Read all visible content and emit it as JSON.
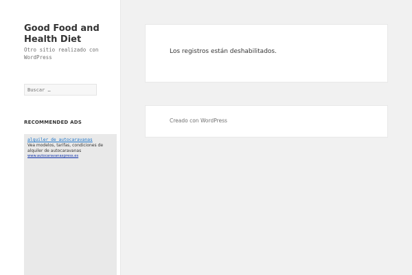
{
  "site": {
    "title": "Good Food and Health Diet",
    "description": "Otro sitio realizado con WordPress"
  },
  "search": {
    "placeholder": "Buscar …"
  },
  "widget": {
    "title": "RECOMMENDED ADS"
  },
  "ad": {
    "link_text": "alquiler de autocaravanas",
    "description": "Vea modelos, tarifas, condiciones de alquiler de autocaravanas",
    "url": "www.autocaravanaxpress.es"
  },
  "main": {
    "message": "Los registros están deshabilitados."
  },
  "footer": {
    "credit": "Creado con WordPress"
  },
  "colors": {
    "background": "#f1f1f1",
    "sidebar": "#ffffff",
    "ad_link": "#1a73c9",
    "ad_url": "#0b2fa8"
  }
}
